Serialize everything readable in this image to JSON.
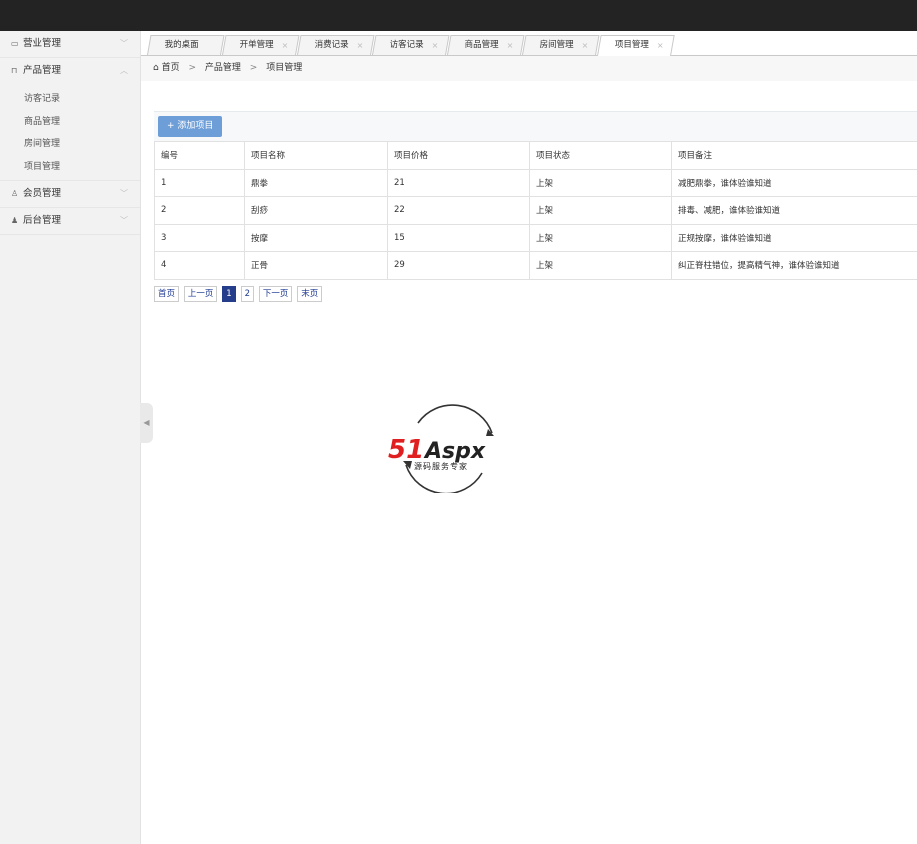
{
  "sidebar": {
    "groups": [
      {
        "label": "营业管理",
        "icon": "monitor-icon"
      },
      {
        "label": "产品管理",
        "icon": "box-icon"
      },
      {
        "label": "会员管理",
        "icon": "user-outline-icon"
      },
      {
        "label": "后台管理",
        "icon": "user-solid-icon"
      }
    ],
    "sub_items": [
      "访客记录",
      "商品管理",
      "房间管理",
      "项目管理"
    ]
  },
  "tabs": [
    {
      "label": "我的桌面",
      "closable": false
    },
    {
      "label": "开单管理",
      "closable": true
    },
    {
      "label": "消费记录",
      "closable": true
    },
    {
      "label": "访客记录",
      "closable": true
    },
    {
      "label": "商品管理",
      "closable": true
    },
    {
      "label": "房间管理",
      "closable": true
    },
    {
      "label": "项目管理",
      "closable": true,
      "active": true
    }
  ],
  "close_glyph": "×",
  "breadcrumb": {
    "home": "首页",
    "sep": ">",
    "level1": "产品管理",
    "level2": "项目管理"
  },
  "toolbar": {
    "add_label": "+ 添加项目"
  },
  "table": {
    "headers": [
      "编号",
      "项目名称",
      "项目价格",
      "项目状态",
      "项目备注"
    ],
    "rows": [
      [
        "1",
        "鼎拳",
        "21",
        "上架",
        "减肥鼎拳，谁体验谁知道"
      ],
      [
        "2",
        "刮痧",
        "22",
        "上架",
        "排毒、减肥，谁体验谁知道"
      ],
      [
        "3",
        "按摩",
        "15",
        "上架",
        "正规按摩，谁体验谁知道"
      ],
      [
        "4",
        "正骨",
        "29",
        "上架",
        "纠正脊柱错位，提高精气神，谁体验谁知道"
      ]
    ]
  },
  "pager": {
    "first": "首页",
    "prev": "上一页",
    "pages": [
      "1",
      "2"
    ],
    "current": "1",
    "next": "下一页",
    "last": "末页"
  },
  "logo": {
    "brand_red": "51",
    "brand_black": "Aspx",
    "tagline": "源码服务专家"
  },
  "colors": {
    "topbar": "#232323",
    "accent_blue": "#6e9ed8",
    "active_page": "#253e8c",
    "logo_red": "#e02020",
    "logo_green": "#2aa52a"
  }
}
